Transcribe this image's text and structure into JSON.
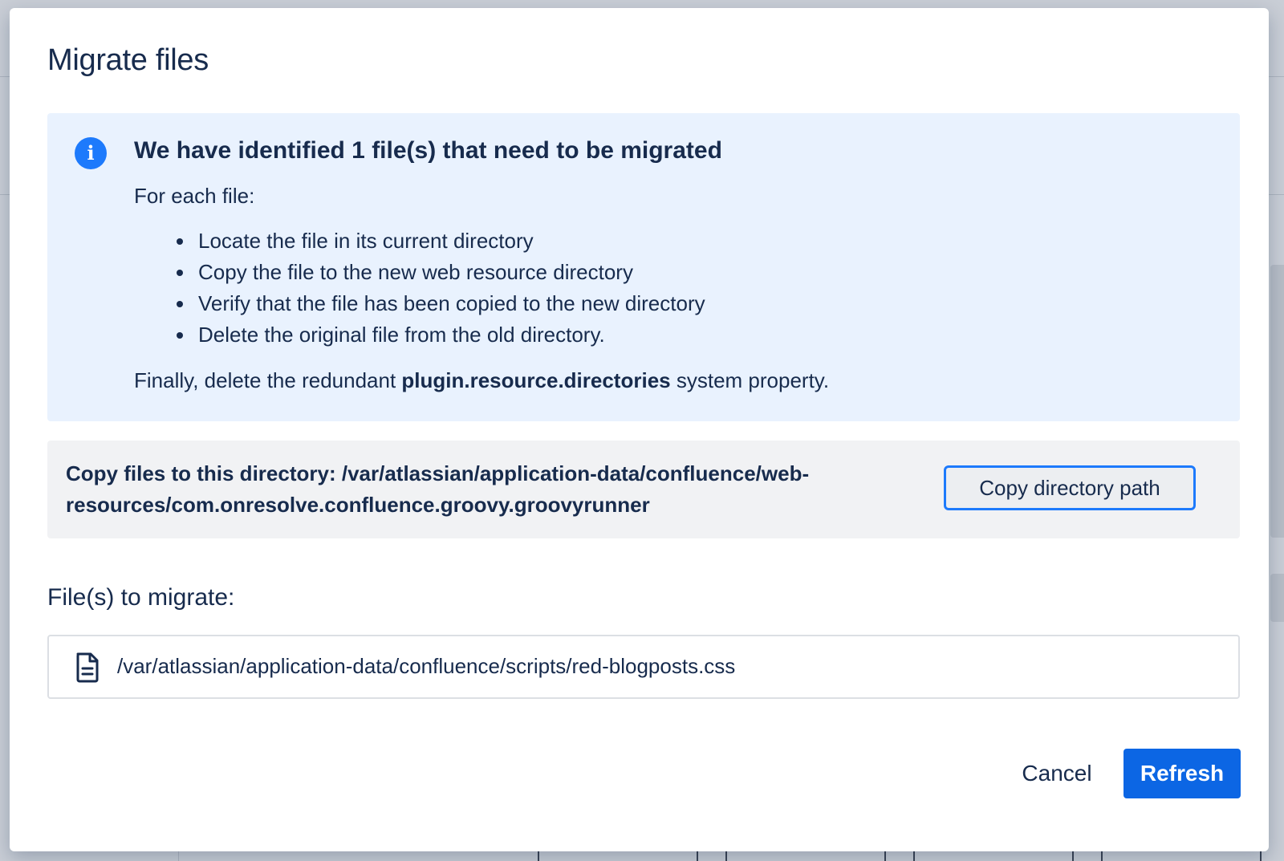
{
  "dialog": {
    "title": "Migrate files",
    "info": {
      "heading": "We have identified 1 file(s) that need to be migrated",
      "intro": "For each file:",
      "steps": [
        "Locate the file in its current directory",
        "Copy the file to the new web resource directory",
        "Verify that the file has been copied to the new directory",
        "Delete the original file from the old directory."
      ],
      "final_prefix": "Finally, delete the redundant ",
      "final_property": "plugin.resource.directories",
      "final_suffix": " system property.",
      "icon": "info-icon"
    },
    "directory": {
      "label": "Copy files to this directory:",
      "path": "/var/atlassian/application-data/confluence/web-resources/com.onresolve.confluence.groovy.groovyrunner",
      "copy_button_label": "Copy directory path"
    },
    "files": {
      "label": "File(s) to migrate:",
      "items": [
        {
          "path": "/var/atlassian/application-data/confluence/scripts/red-blogposts.css",
          "icon": "document-icon"
        }
      ]
    },
    "footer": {
      "cancel_label": "Cancel",
      "refresh_label": "Refresh"
    }
  },
  "colors": {
    "text": "#172b4d",
    "info_bg": "#e9f2fe",
    "info_icon": "#1d7afc",
    "primary_button": "#0c66e4",
    "focus_ring": "#1d7afc",
    "section_bg": "#f1f2f4",
    "overlay": "#7e8797"
  }
}
